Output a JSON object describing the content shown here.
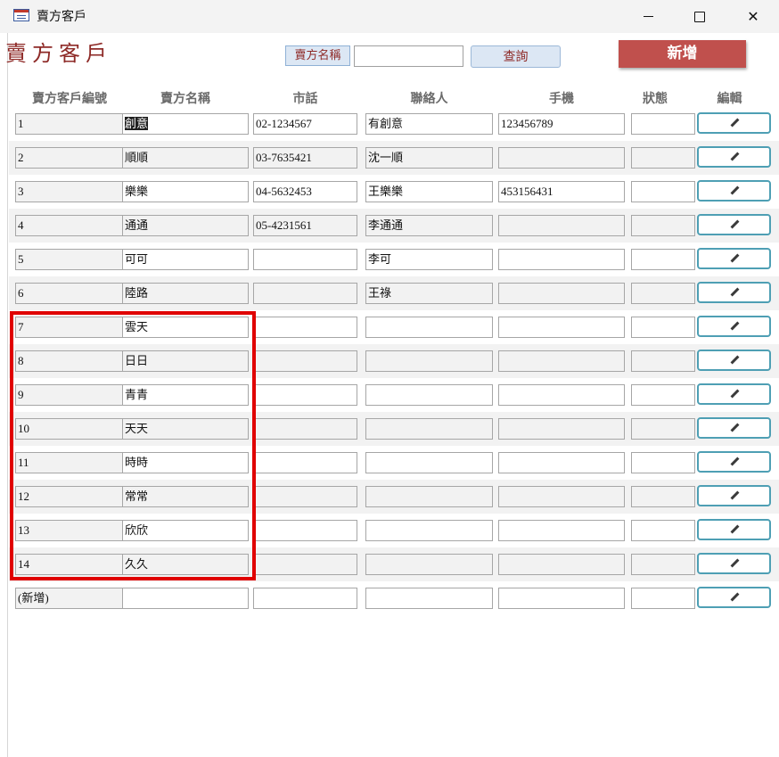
{
  "window": {
    "title": "賣方客戶"
  },
  "form": {
    "title": "賣方客戶",
    "search_label": "賣方名稱",
    "search_value": "",
    "query_button": "查詢",
    "add_button": "新增"
  },
  "columns": [
    "賣方客戶編號",
    "賣方名稱",
    "市話",
    "聯絡人",
    "手機",
    "狀態",
    "編輯"
  ],
  "rows": [
    {
      "id": "1",
      "name": "創意",
      "phone": "02-1234567",
      "contact": "有創意",
      "mobile": "123456789",
      "status": ""
    },
    {
      "id": "2",
      "name": "順順",
      "phone": "03-7635421",
      "contact": "沈一順",
      "mobile": "",
      "status": ""
    },
    {
      "id": "3",
      "name": "樂樂",
      "phone": "04-5632453",
      "contact": "王樂樂",
      "mobile": "453156431",
      "status": ""
    },
    {
      "id": "4",
      "name": "通通",
      "phone": "05-4231561",
      "contact": "李通通",
      "mobile": "",
      "status": ""
    },
    {
      "id": "5",
      "name": "可可",
      "phone": "",
      "contact": "李可",
      "mobile": "",
      "status": ""
    },
    {
      "id": "6",
      "name": "陸路",
      "phone": "",
      "contact": "王祿",
      "mobile": "",
      "status": ""
    },
    {
      "id": "7",
      "name": "雲天",
      "phone": "",
      "contact": "",
      "mobile": "",
      "status": ""
    },
    {
      "id": "8",
      "name": "日日",
      "phone": "",
      "contact": "",
      "mobile": "",
      "status": ""
    },
    {
      "id": "9",
      "name": "青青",
      "phone": "",
      "contact": "",
      "mobile": "",
      "status": ""
    },
    {
      "id": "10",
      "name": "天天",
      "phone": "",
      "contact": "",
      "mobile": "",
      "status": ""
    },
    {
      "id": "11",
      "name": "時時",
      "phone": "",
      "contact": "",
      "mobile": "",
      "status": ""
    },
    {
      "id": "12",
      "name": "常常",
      "phone": "",
      "contact": "",
      "mobile": "",
      "status": ""
    },
    {
      "id": "13",
      "name": "欣欣",
      "phone": "",
      "contact": "",
      "mobile": "",
      "status": ""
    },
    {
      "id": "14",
      "name": "久久",
      "phone": "",
      "contact": "",
      "mobile": "",
      "status": ""
    },
    {
      "id": "(新增)",
      "name": "",
      "phone": "",
      "contact": "",
      "mobile": "",
      "status": ""
    }
  ],
  "icons": {
    "edit": "pencil-icon",
    "app": "form-icon"
  },
  "colors": {
    "accent": "#c0504d",
    "title_text": "#8e2a27",
    "edit_border": "#4e9fb4",
    "highlight": "#e00000"
  }
}
